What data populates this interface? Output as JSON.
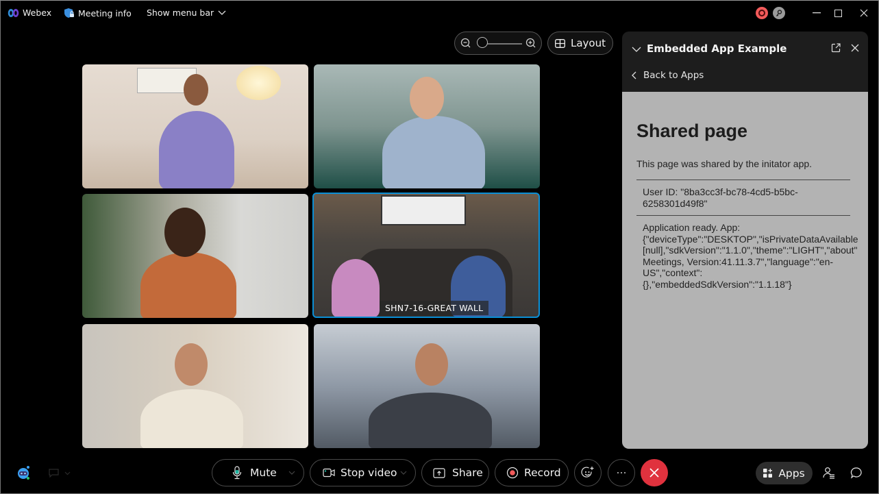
{
  "titlebar": {
    "app_name": "Webex",
    "meeting_info": "Meeting info",
    "show_menu_bar": "Show menu bar",
    "status_colors": {
      "recording": "#f25a5a",
      "locked": "#9b9b9b"
    }
  },
  "view_controls": {
    "zoom_level": 0,
    "layout_label": "Layout"
  },
  "video_grid": {
    "tiles": [
      {
        "id": 1,
        "label": ""
      },
      {
        "id": 2,
        "label": ""
      },
      {
        "id": 3,
        "label": ""
      },
      {
        "id": 4,
        "label": "SHN7-16-GREAT WALL",
        "active_speaker": true
      },
      {
        "id": 5,
        "label": ""
      },
      {
        "id": 6,
        "label": ""
      }
    ],
    "active_color": "#0a8fd6"
  },
  "panel": {
    "title": "Embedded App Example",
    "back_label": "Back to Apps",
    "content": {
      "heading": "Shared page",
      "description": "This page was shared by the initator app.",
      "user_id_line1": "User ID: \"8ba3cc3f-bc78-4cd5-b5bc-",
      "user_id_line2": "6258301d49f8\"",
      "app_lines": [
        "Application ready. App:",
        "{\"deviceType\":\"DESKTOP\",\"isPrivateDataAvailable",
        "[null],\"sdkVersion\":\"1.1.0\",\"theme\":\"LIGHT\",\"about\"",
        "Meetings, Version:41.11.3.7\",\"language\":\"en-",
        "US\",\"context\":",
        "{},\"embeddedSdkVersion\":\"1.1.18\"}"
      ]
    }
  },
  "controls": {
    "mute_label": "Mute",
    "stop_video_label": "Stop video",
    "share_label": "Share",
    "record_label": "Record",
    "apps_label": "Apps",
    "end_color": "#e0323e"
  }
}
